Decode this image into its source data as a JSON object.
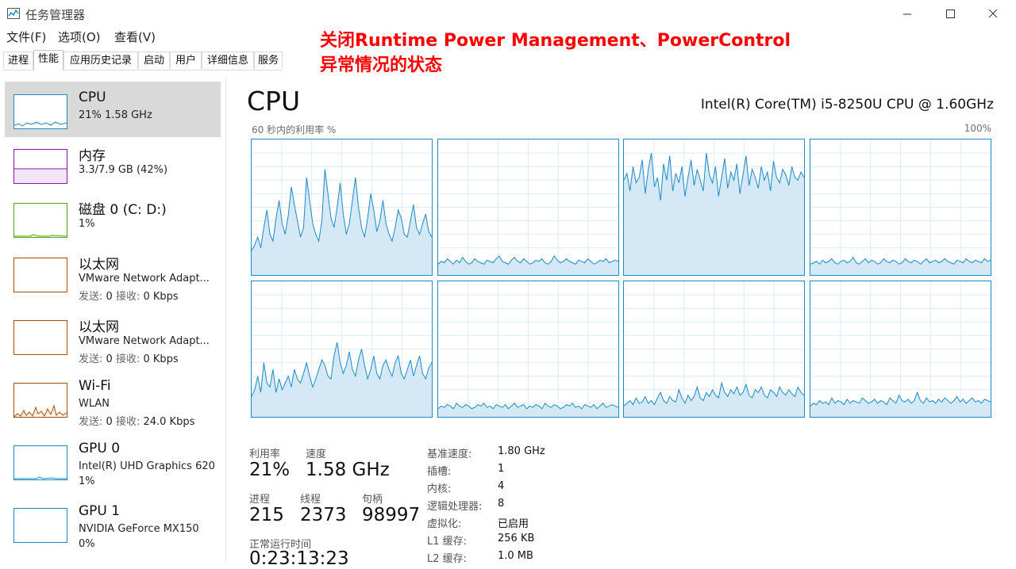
{
  "window": {
    "title": "任务管理器"
  },
  "menu": {
    "file": "文件(F)",
    "options": "选项(O)",
    "view": "查看(V)"
  },
  "annotation": {
    "line1": "关闭Runtime Power Management、PowerControl",
    "line2": "异常情况的状态"
  },
  "tabs": [
    "进程",
    "性能",
    "应用历史记录",
    "启动",
    "用户",
    "详细信息",
    "服务"
  ],
  "active_tab": "性能",
  "sidebar": {
    "items": [
      {
        "name": "CPU",
        "sub": "21% 1.58 GHz",
        "color": "#1b8ac7"
      },
      {
        "name": "内存",
        "sub": "3.3/7.9 GB (42%)",
        "color": "#8b12ae"
      },
      {
        "name": "磁盘 0 (C: D:)",
        "sub": "1%",
        "color": "#4da60c"
      },
      {
        "name": "以太网",
        "sub": "VMware Network Adapt...",
        "send_label": "发送:",
        "send": "0",
        "recv_label": "接收:",
        "recv": "0 Kbps",
        "color": "#a74f01"
      },
      {
        "name": "以太网",
        "sub": "VMware Network Adapt...",
        "send_label": "发送:",
        "send": "0",
        "recv_label": "接收:",
        "recv": "0 Kbps",
        "color": "#a74f01"
      },
      {
        "name": "Wi-Fi",
        "sub": "WLAN",
        "send_label": "发送:",
        "send": "0",
        "recv_label": "接收:",
        "recv": "24.0 Kbps",
        "color": "#a74f01"
      },
      {
        "name": "GPU 0",
        "sub": "Intel(R) UHD Graphics 620",
        "sub2": "1%",
        "color": "#1b8ac7"
      },
      {
        "name": "GPU 1",
        "sub": "NVIDIA GeForce MX150",
        "sub2": "0%",
        "color": "#1b8ac7"
      }
    ]
  },
  "main": {
    "title": "CPU",
    "model": "Intel(R) Core(TM) i5-8250U CPU @ 1.60GHz",
    "graph_label": "60 秒内的利用率 %",
    "graph_max": "100%"
  },
  "stats": {
    "utilization_label": "利用率",
    "utilization": "21%",
    "speed_label": "速度",
    "speed": "1.58 GHz",
    "processes_label": "进程",
    "processes": "215",
    "threads_label": "线程",
    "threads": "2373",
    "handles_label": "句柄",
    "handles": "98997",
    "uptime_label": "正常运行时间",
    "uptime": "0:23:13:23"
  },
  "specs": [
    {
      "label": "基准速度:",
      "value": "1.80 GHz"
    },
    {
      "label": "插槽:",
      "value": "1"
    },
    {
      "label": "内核:",
      "value": "4"
    },
    {
      "label": "逻辑处理器:",
      "value": "8"
    },
    {
      "label": "虚拟化:",
      "value": "已启用"
    },
    {
      "label": "L1 缓存:",
      "value": "256 KB"
    },
    {
      "label": "L2 缓存:",
      "value": "1.0 MB"
    }
  ],
  "cores": [
    [
      18,
      22,
      28,
      20,
      35,
      48,
      30,
      25,
      42,
      55,
      38,
      30,
      44,
      65,
      52,
      40,
      28,
      35,
      72,
      55,
      38,
      30,
      25,
      40,
      78,
      60,
      42,
      35,
      50,
      68,
      45,
      30,
      38,
      55,
      72,
      50,
      35,
      28,
      42,
      60,
      48,
      32,
      40,
      55,
      38,
      30,
      25,
      35,
      48,
      42,
      30,
      28,
      40,
      52,
      35,
      30,
      38,
      45,
      32,
      28
    ],
    [
      8,
      10,
      9,
      12,
      10,
      8,
      11,
      9,
      13,
      10,
      8,
      9,
      12,
      10,
      9,
      8,
      11,
      10,
      9,
      12,
      14,
      10,
      9,
      8,
      11,
      13,
      10,
      9,
      12,
      10,
      8,
      9,
      11,
      10,
      12,
      9,
      8,
      10,
      14,
      11,
      9,
      10,
      12,
      10,
      9,
      8,
      11,
      10,
      9,
      12,
      10,
      8,
      9,
      11,
      10,
      12,
      9,
      10,
      11,
      10
    ],
    [
      70,
      75,
      62,
      80,
      68,
      72,
      85,
      60,
      78,
      90,
      65,
      72,
      55,
      82,
      70,
      88,
      62,
      75,
      68,
      80,
      58,
      72,
      85,
      66,
      78,
      70,
      62,
      90,
      74,
      68,
      80,
      58,
      72,
      86,
      64,
      76,
      70,
      82,
      60,
      74,
      88,
      66,
      78,
      72,
      64,
      80,
      70,
      76,
      62,
      84,
      72,
      68,
      78,
      74,
      66,
      80,
      72,
      70,
      76,
      72
    ],
    [
      8,
      9,
      10,
      8,
      11,
      9,
      10,
      12,
      9,
      8,
      10,
      11,
      9,
      10,
      13,
      9,
      8,
      10,
      12,
      9,
      11,
      10,
      8,
      9,
      12,
      10,
      9,
      11,
      10,
      8,
      9,
      12,
      10,
      9,
      11,
      10,
      8,
      10,
      12,
      9,
      10,
      11,
      9,
      10,
      12,
      10,
      9,
      8,
      11,
      10,
      9,
      12,
      10,
      9,
      11,
      10,
      9,
      12,
      10,
      11
    ],
    [
      15,
      20,
      30,
      18,
      40,
      25,
      22,
      35,
      18,
      28,
      20,
      25,
      30,
      22,
      35,
      28,
      25,
      32,
      40,
      30,
      22,
      28,
      35,
      42,
      38,
      30,
      28,
      45,
      55,
      40,
      32,
      38,
      48,
      35,
      30,
      42,
      50,
      38,
      28,
      35,
      45,
      32,
      28,
      38,
      42,
      35,
      30,
      40,
      45,
      32,
      28,
      35,
      42,
      30,
      38,
      45,
      32,
      28,
      36,
      40
    ],
    [
      6,
      8,
      7,
      9,
      8,
      6,
      10,
      8,
      7,
      9,
      8,
      6,
      7,
      9,
      8,
      10,
      7,
      8,
      6,
      9,
      8,
      7,
      9,
      6,
      8,
      10,
      7,
      8,
      9,
      6,
      8,
      7,
      9,
      8,
      6,
      10,
      8,
      7,
      9,
      8,
      6,
      7,
      9,
      8,
      10,
      7,
      8,
      6,
      9,
      8,
      7,
      9,
      6,
      8,
      10,
      7,
      8,
      9,
      8,
      7
    ],
    [
      8,
      10,
      12,
      9,
      14,
      10,
      11,
      15,
      10,
      12,
      9,
      14,
      18,
      12,
      10,
      15,
      12,
      11,
      20,
      14,
      10,
      16,
      12,
      15,
      22,
      14,
      12,
      18,
      15,
      20,
      16,
      14,
      25,
      18,
      15,
      20,
      17,
      22,
      16,
      18,
      24,
      16,
      14,
      20,
      18,
      22,
      16,
      14,
      20,
      18,
      15,
      22,
      18,
      16,
      20,
      17,
      15,
      22,
      18,
      16
    ],
    [
      8,
      10,
      9,
      12,
      10,
      11,
      9,
      14,
      10,
      12,
      11,
      9,
      13,
      10,
      12,
      11,
      10,
      14,
      12,
      10,
      11,
      13,
      10,
      12,
      11,
      9,
      14,
      12,
      10,
      16,
      12,
      11,
      13,
      10,
      12,
      18,
      12,
      10,
      14,
      11,
      12,
      10,
      13,
      11,
      14,
      12,
      10,
      12,
      15,
      11,
      13,
      10,
      12,
      14,
      11,
      12,
      10,
      13,
      12,
      11
    ]
  ]
}
